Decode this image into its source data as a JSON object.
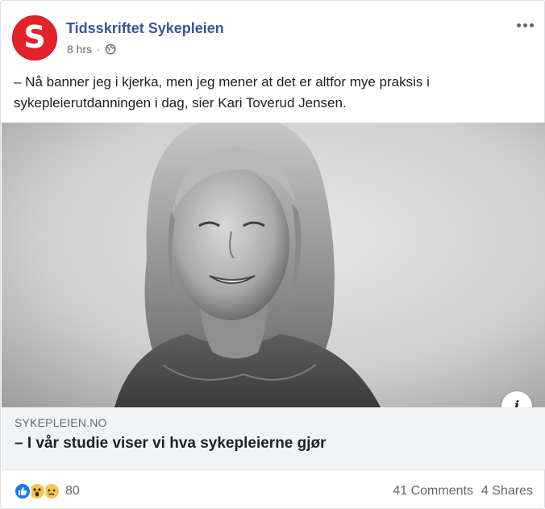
{
  "post": {
    "page_name": "Tidsskriftet Sykepleien",
    "avatar_letter": "S",
    "time": "8 hrs",
    "separator": "·",
    "privacy_icon": "globe-icon",
    "more_icon": "more-options-icon",
    "text": "– Nå banner jeg i kjerka, men jeg mener at det er altfor mye praksis i sykepleierutdanningen i dag, sier Kari Toverud Jensen."
  },
  "link": {
    "domain": "SYKEPLEIEN.NO",
    "headline": "– I vår studie viser vi hva sykepleierne gjør",
    "info_label": "i"
  },
  "engagement": {
    "reactions": [
      "like-icon",
      "wow-icon",
      "sad-icon"
    ],
    "reaction_count": "80",
    "comments": "41 Comments",
    "shares": "4 Shares"
  },
  "colors": {
    "brand_red": "#e32229",
    "link_blue": "#385898",
    "like_blue": "#1877f2",
    "emoji_yellow": "#f7c44a"
  }
}
